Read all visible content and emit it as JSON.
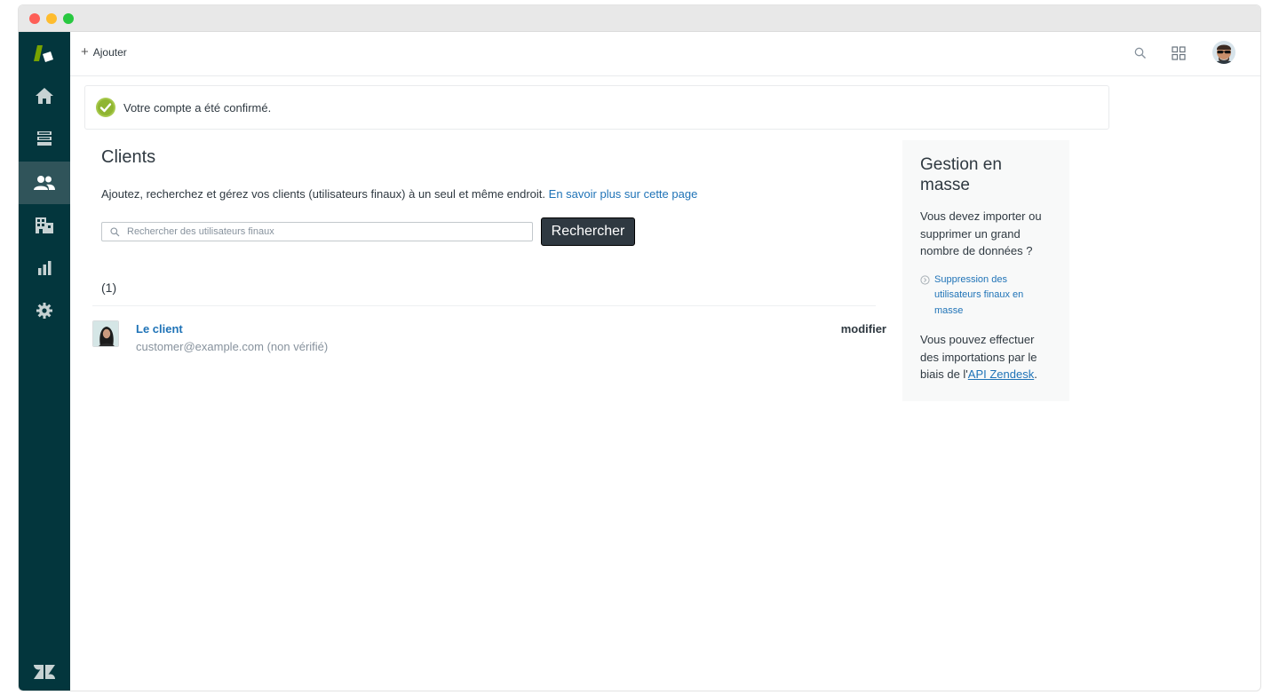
{
  "window": {
    "traffic_lights": [
      "close",
      "minimize",
      "maximize"
    ]
  },
  "sidebar": {
    "logo_icon": "zendesk-product-logo",
    "items": [
      {
        "name": "home",
        "icon": "home-icon",
        "active": false
      },
      {
        "name": "views",
        "icon": "views-icon",
        "active": false
      },
      {
        "name": "customers",
        "icon": "users-icon",
        "active": true
      },
      {
        "name": "organizations",
        "icon": "building-icon",
        "active": false
      },
      {
        "name": "reporting",
        "icon": "bar-chart-icon",
        "active": false
      },
      {
        "name": "admin",
        "icon": "gear-icon",
        "active": false
      }
    ],
    "footer_icon": "zendesk-z-icon"
  },
  "topbar": {
    "add_label": "Ajouter",
    "icons": [
      "search-icon",
      "apps-grid-icon",
      "avatar"
    ]
  },
  "banner": {
    "message": "Votre compte a été confirmé.",
    "icon": "check-circle-icon",
    "accent": "#78a300"
  },
  "main": {
    "title": "Clients",
    "description": "Ajoutez, recherchez et gérez vos clients (utilisateurs finaux) à un seul et même endroit.",
    "learn_more": "En savoir plus sur cette page",
    "search_placeholder": "Rechercher des utilisateurs finaux",
    "search_value": "",
    "search_button": "Rechercher",
    "count": "(1)",
    "users": [
      {
        "name": "Le client",
        "email": "customer@example.com (non vérifié)",
        "edit": "modifier"
      }
    ]
  },
  "aside": {
    "title": "Gestion en masse",
    "question": "Vous devez importer ou supprimer un grand nombre de données ?",
    "link": "Suppression des utilisateurs finaux en masse",
    "import_text_prefix": "Vous pouvez effectuer des importations par le biais de l'",
    "import_link": "API Zendesk",
    "import_text_suffix": "."
  },
  "colors": {
    "sidebar_bg": "#03363d",
    "sidebar_active": "#30545a",
    "link": "#1f73b7",
    "button_bg": "#2f3941"
  }
}
